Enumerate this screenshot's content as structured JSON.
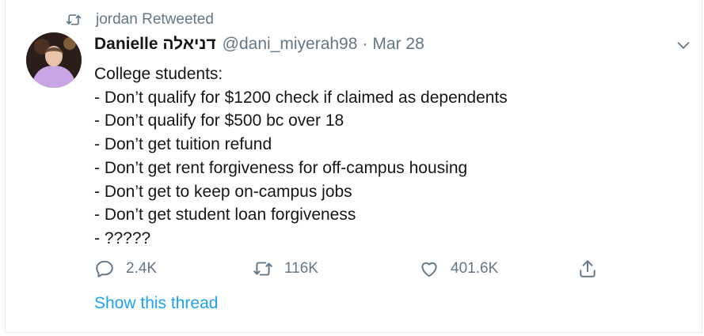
{
  "retweet_context": {
    "icon": "retweet-icon",
    "text": "jordan Retweeted"
  },
  "author": {
    "display_name": "Danielle דניאלה",
    "handle": "@dani_miyerah98",
    "separator": "·",
    "date": "Mar 28"
  },
  "tweet_lines": [
    "College students:",
    "- Don’t qualify for $1200 check if claimed as dependents",
    "- Don’t qualify for $500 bc over 18",
    "- Don’t get tuition refund",
    "- Don’t get rent forgiveness for off-campus housing",
    "- Don’t get to keep on-campus jobs",
    "- Don’t get student loan forgiveness",
    "- ?????"
  ],
  "actions": {
    "reply": {
      "icon": "reply-icon",
      "count": "2.4K"
    },
    "retweet": {
      "icon": "retweet-icon",
      "count": "116K"
    },
    "like": {
      "icon": "heart-icon",
      "count": "401.6K"
    },
    "share": {
      "icon": "share-icon"
    }
  },
  "show_thread": "Show this thread",
  "colors": {
    "text": "#14171a",
    "secondary": "#657786",
    "link": "#1da1f2",
    "border": "#e6ecf0"
  }
}
